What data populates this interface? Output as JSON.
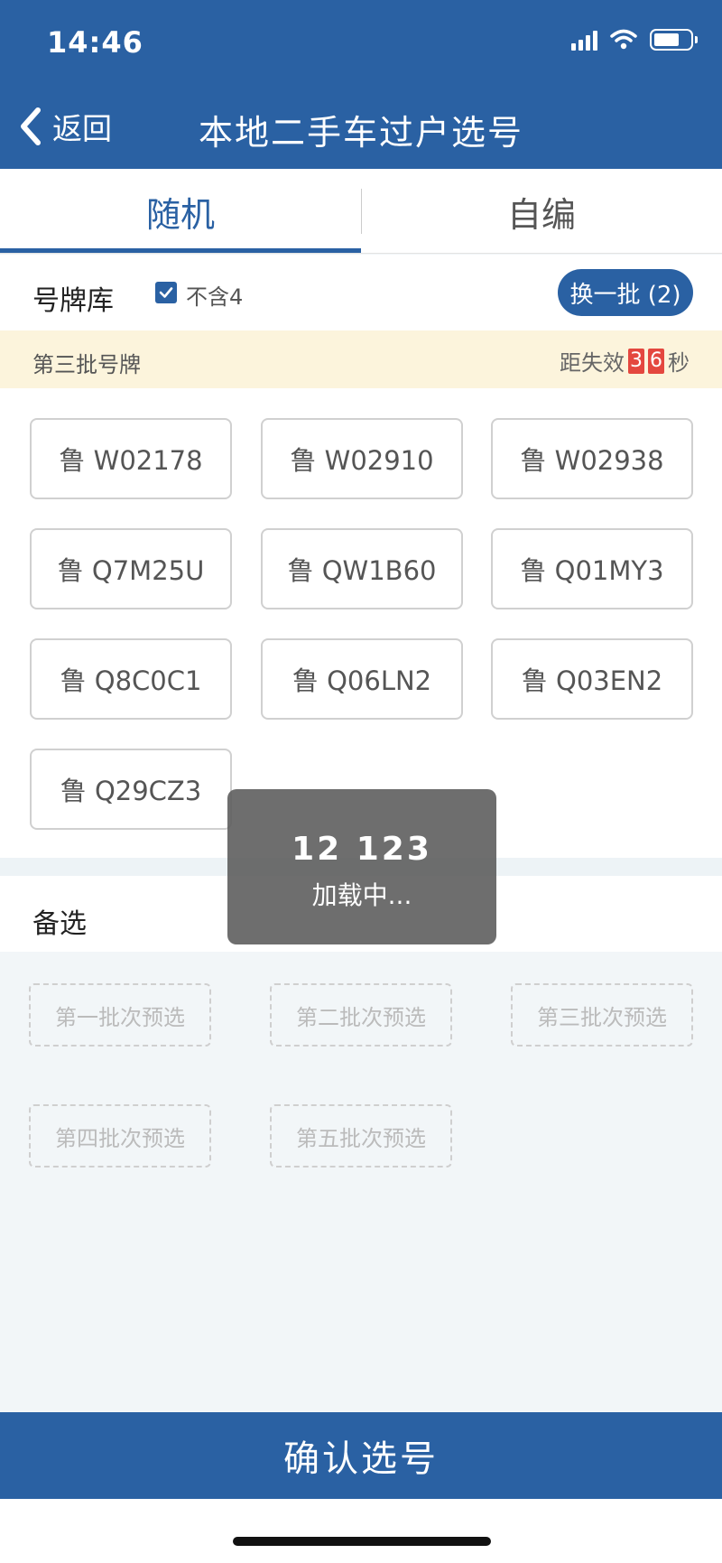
{
  "status_bar": {
    "time": "14:46"
  },
  "header": {
    "back_label": "返回",
    "title": "本地二手车过户选号"
  },
  "tabs": [
    {
      "label": "随机",
      "active": true
    },
    {
      "label": "自编",
      "active": false
    }
  ],
  "pool": {
    "title": "号牌库",
    "exclude_four_label": "不含4",
    "exclude_four_checked": true,
    "refresh_label": "换一批 (2)"
  },
  "batch": {
    "title": "第三批号牌",
    "countdown_prefix": "距失效",
    "countdown_digits": [
      "3",
      "6"
    ],
    "countdown_unit": "秒"
  },
  "plates": [
    "鲁 W02178",
    "鲁 W02910",
    "鲁 W02938",
    "鲁 Q7M25U",
    "鲁 QW1B60",
    "鲁 Q01MY3",
    "鲁 Q8C0C1",
    "鲁 Q06LN2",
    "鲁 Q03EN2",
    "鲁 Q29CZ3"
  ],
  "alternates": {
    "title": "备选",
    "slots": [
      "第一批次预选",
      "第二批次预选",
      "第三批次预选",
      "第四批次预选",
      "第五批次预选"
    ]
  },
  "loading": {
    "number": "12 123",
    "text": "加载中..."
  },
  "confirm_label": "确认选号",
  "colors": {
    "brand": "#2a61a3",
    "countdown": "#e4473f",
    "batch_bg": "#fcf4dc"
  },
  "icons": [
    "chevron-left-icon",
    "signal-icon",
    "wifi-icon",
    "battery-icon",
    "checkbox-checked-icon"
  ]
}
